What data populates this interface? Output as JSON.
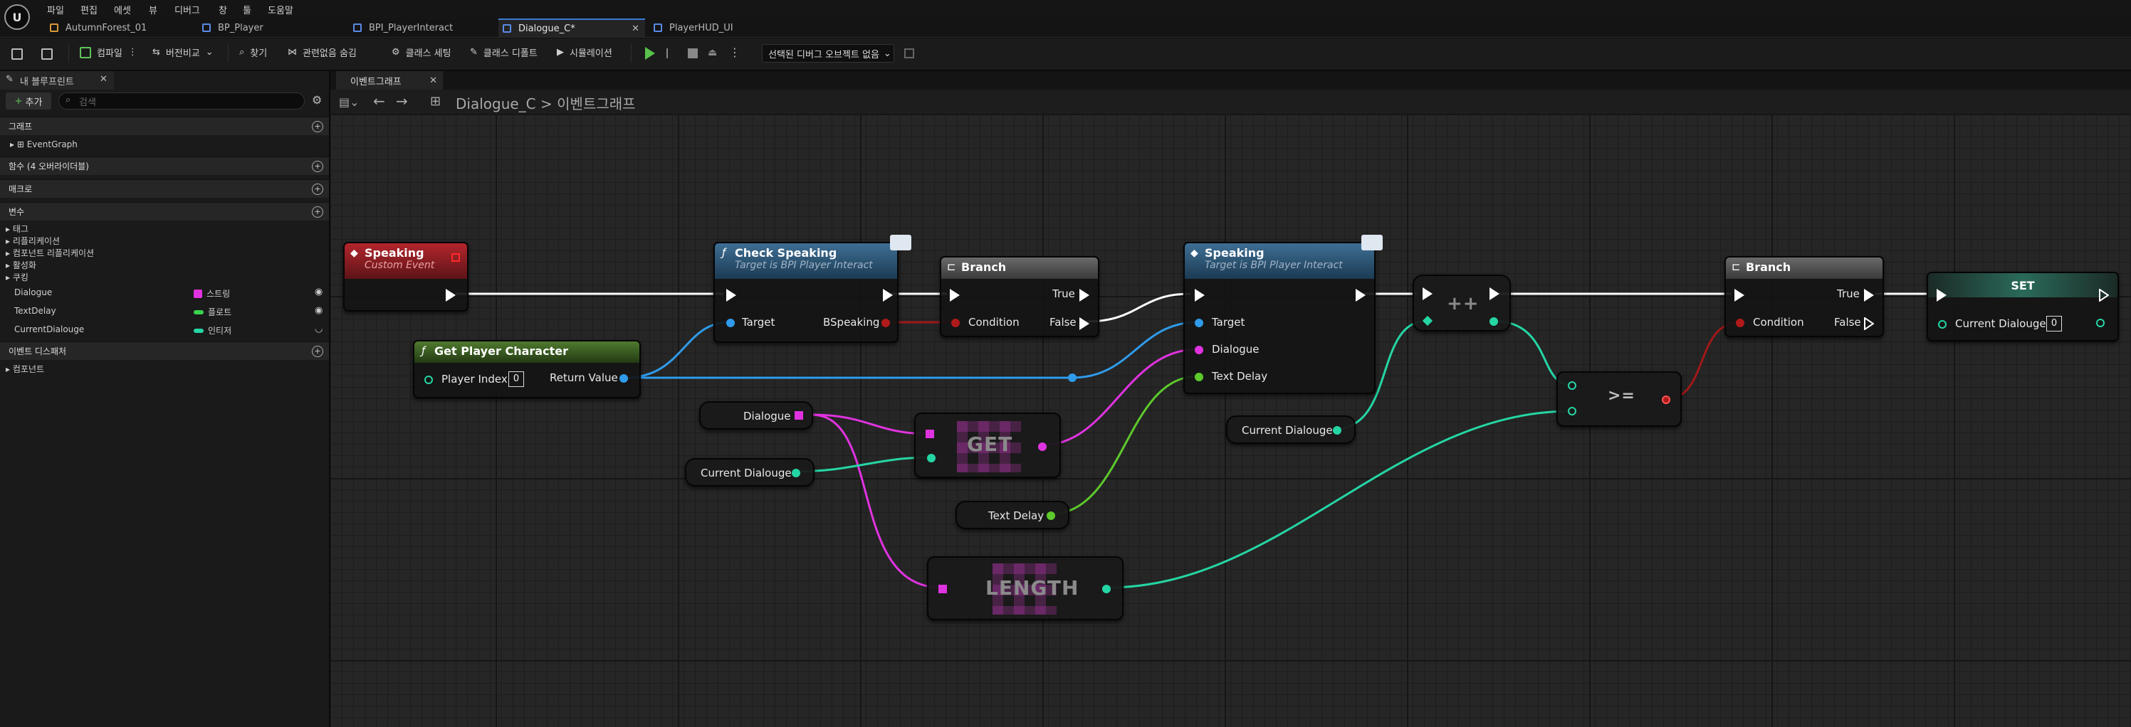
{
  "menu": [
    "파일",
    "편집",
    "에셋",
    "뷰",
    "디버그",
    "창",
    "툴",
    "도움말"
  ],
  "tabs": [
    {
      "label": "AutumnForest_01",
      "active": false,
      "kind": "level"
    },
    {
      "label": "BP_Player",
      "active": false,
      "kind": "blueprint"
    },
    {
      "label": "BPI_PlayerInteract",
      "active": false,
      "kind": "interface"
    },
    {
      "label": "Dialogue_C*",
      "active": true,
      "kind": "blueprint"
    },
    {
      "label": "PlayerHUD_UI",
      "active": false,
      "kind": "widget"
    }
  ],
  "toolbar": {
    "compile": "컴파일",
    "diff": "버전비교",
    "find": "찾기",
    "hide_unrelated": "관련없음 숨김",
    "class_settings": "클래스 세팅",
    "class_defaults": "클래스 디폴트",
    "simulation": "시뮬레이션",
    "debug_object": "선택된 디버그 오브젝트 없음"
  },
  "left_panel": {
    "tab_title": "내 블루프린트",
    "add_label": "추가",
    "search_placeholder": "검색",
    "sections": {
      "graphs": "그래프",
      "functions": "함수 (4 오버라이더블)",
      "macros": "매크로",
      "variables": "변수",
      "dispatchers": "이벤트 디스패처"
    },
    "graph_items": [
      "EventGraph"
    ],
    "var_groups": [
      "태그",
      "리플리케이션",
      "컴포넌트 리플리케이션",
      "활성화",
      "쿠킹"
    ],
    "variables": [
      {
        "name": "Dialogue",
        "type": "스트링",
        "color": "#e033e0"
      },
      {
        "name": "TextDelay",
        "type": "플로트",
        "color": "#39d34d"
      },
      {
        "name": "CurrentDialouge",
        "type": "인티저",
        "color": "#25d6a5"
      }
    ],
    "components_label": "컴포넌트"
  },
  "graph": {
    "tab_title": "이벤트그래프",
    "breadcrumb_class": "Dialogue_C",
    "breadcrumb_sep": ">",
    "breadcrumb_graph": "이벤트그래프"
  },
  "nodes": {
    "speaking_event": {
      "title": "Speaking",
      "subtitle": "Custom Event"
    },
    "get_player": {
      "title": "Get Player Character",
      "pin_in": "Player Index",
      "pin_in_value": "0",
      "pin_out": "Return Value"
    },
    "check_speaking": {
      "title": "Check Speaking",
      "subtitle": "Target is BPI Player Interact",
      "target": "Target",
      "out": "BSpeaking"
    },
    "branch1": {
      "title": "Branch",
      "cond": "Condition",
      "t": "True",
      "f": "False"
    },
    "speaking_msg": {
      "title": "Speaking",
      "subtitle": "Target is BPI Player Interact",
      "target": "Target",
      "dialogue": "Dialogue",
      "text_delay": "Text Delay"
    },
    "increment": {
      "label": "++"
    },
    "branch2": {
      "title": "Branch",
      "cond": "Condition",
      "t": "True",
      "f": "False"
    },
    "set": {
      "title": "SET",
      "pin": "Current Dialouge",
      "value": "0"
    },
    "var_dialogue": {
      "label": "Dialogue"
    },
    "var_current1": {
      "label": "Current Dialouge"
    },
    "var_textdelay": {
      "label": "Text Delay"
    },
    "var_current2": {
      "label": "Current Dialouge"
    },
    "get": {
      "label": "GET"
    },
    "length": {
      "label": "LENGTH"
    },
    "gte": {
      "label": ">="
    }
  }
}
